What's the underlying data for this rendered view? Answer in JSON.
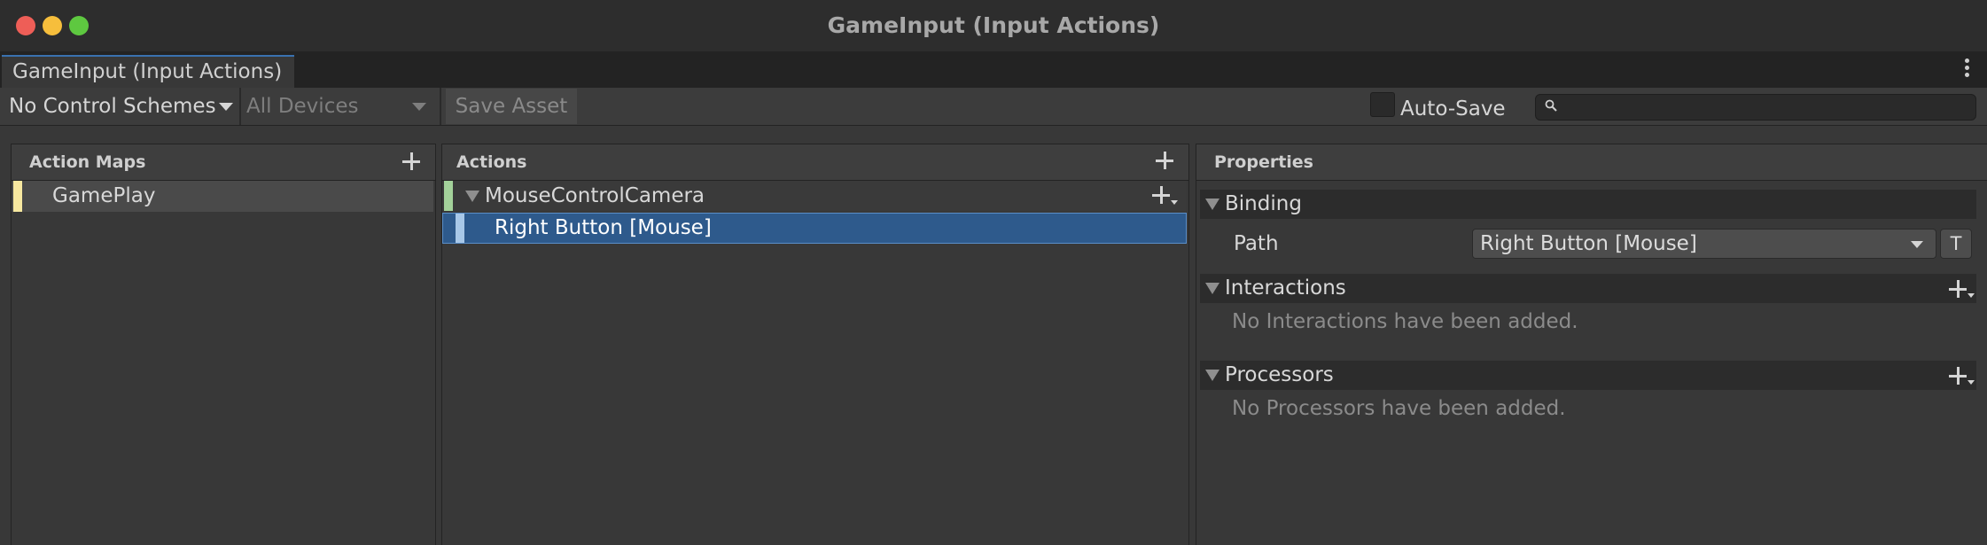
{
  "window": {
    "title": "GameInput (Input Actions)",
    "tab_label": "GameInput (Input Actions)"
  },
  "toolbar": {
    "control_schemes": "No Control Schemes",
    "devices": "All Devices",
    "save_asset": "Save Asset",
    "auto_save_label": "Auto-Save",
    "auto_save_checked": false,
    "search_value": ""
  },
  "action_maps": {
    "title": "Action Maps",
    "items": [
      {
        "label": "GamePlay",
        "selected": true
      }
    ]
  },
  "actions": {
    "title": "Actions",
    "items": [
      {
        "label": "MouseControlCamera",
        "expanded": true,
        "bindings": [
          {
            "label": "Right Button [Mouse]",
            "selected": true
          }
        ]
      }
    ]
  },
  "properties": {
    "title": "Properties",
    "binding_section": "Binding",
    "path_label": "Path",
    "path_value": "Right Button [Mouse]",
    "t_button": "T",
    "interactions_section": "Interactions",
    "interactions_empty": "No Interactions have been added.",
    "processors_section": "Processors",
    "processors_empty": "No Processors have been added."
  },
  "colors": {
    "action_map_color": "#f7e8a0",
    "action_color": "#a3d19a",
    "binding_color": "#a8c8e8",
    "selection": "#2e5a8c",
    "close_light": "#ee5e57",
    "minimize_light": "#f6be3c",
    "zoom_light": "#5ec840"
  },
  "icons": [
    "close-light",
    "minimize-light",
    "zoom-light",
    "more-options-icon",
    "dropdown-arrow-icon",
    "search-icon",
    "plus-icon",
    "plus-dropdown-icon",
    "foldout-triangle-icon"
  ]
}
